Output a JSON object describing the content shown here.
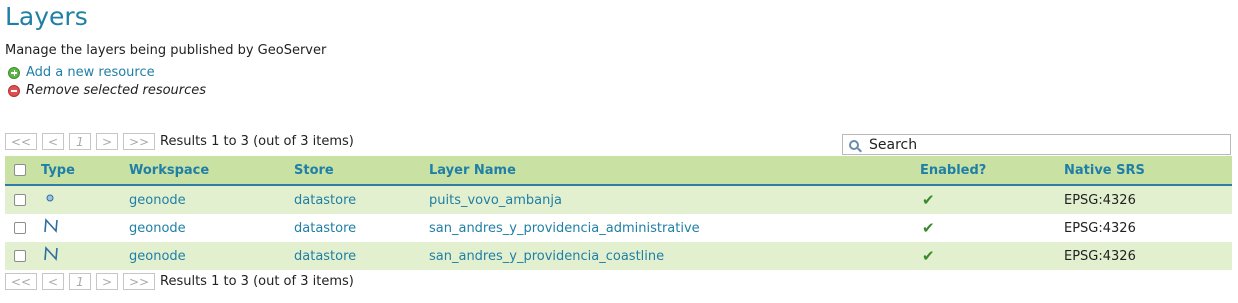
{
  "page": {
    "title": "Layers",
    "subtitle": "Manage the layers being published by GeoServer"
  },
  "actions": {
    "add": "Add a new resource",
    "remove": "Remove selected resources"
  },
  "pager": {
    "first": "<<",
    "prev": "<",
    "current": "1",
    "next": ">",
    "last": ">>",
    "results": "Results 1 to 3 (out of 3 items)"
  },
  "search": {
    "value": "Search"
  },
  "table": {
    "headers": {
      "type": "Type",
      "workspace": "Workspace",
      "store": "Store",
      "layer_name": "Layer Name",
      "enabled": "Enabled?",
      "srs": "Native SRS"
    },
    "rows": [
      {
        "type_icon": "point-icon",
        "workspace": "geonode",
        "store": "datastore",
        "layer_name": "puits_vovo_ambanja",
        "enabled": "✔",
        "srs": "EPSG:4326"
      },
      {
        "type_icon": "line-icon",
        "workspace": "geonode",
        "store": "datastore",
        "layer_name": "san_andres_y_providencia_administrative",
        "enabled": "✔",
        "srs": "EPSG:4326"
      },
      {
        "type_icon": "line-icon",
        "workspace": "geonode",
        "store": "datastore",
        "layer_name": "san_andres_y_providencia_coastline",
        "enabled": "✔",
        "srs": "EPSG:4326"
      }
    ]
  },
  "colors": {
    "accent": "#1f7fa6",
    "header_bg": "#c9e1a2",
    "row_alt_bg": "#e3f0cf",
    "check": "#3a8a2a"
  }
}
